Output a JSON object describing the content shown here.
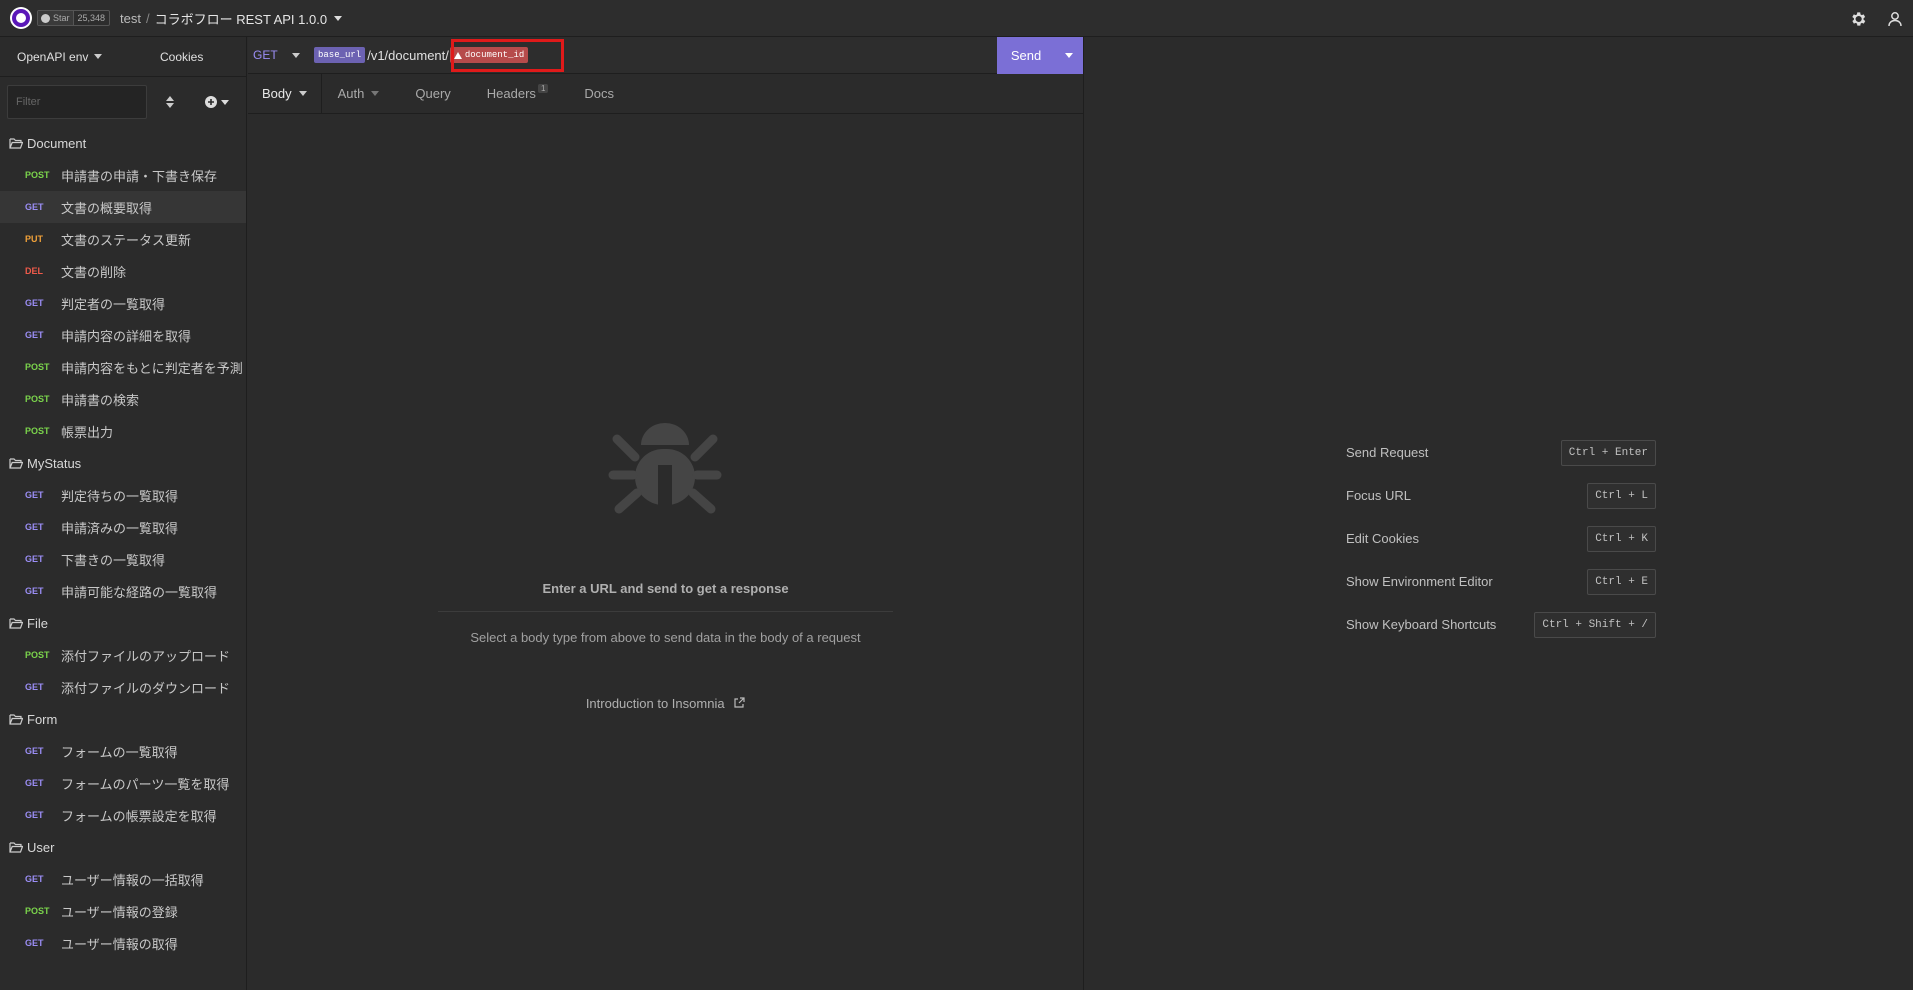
{
  "topbar": {
    "star_label": "Star",
    "star_count": "25,348",
    "workspace": "test",
    "separator": "/",
    "project": "コラボフロー REST API 1.0.0"
  },
  "sidebar": {
    "env_label": "OpenAPI env",
    "cookies_label": "Cookies",
    "filter_placeholder": "Filter",
    "groups": [
      {
        "name": "Document",
        "items": [
          {
            "method": "POST",
            "name": "申請書の申請・下書き保存"
          },
          {
            "method": "GET",
            "name": "文書の概要取得"
          },
          {
            "method": "PUT",
            "name": "文書のステータス更新"
          },
          {
            "method": "DEL",
            "name": "文書の削除"
          },
          {
            "method": "GET",
            "name": "判定者の一覧取得"
          },
          {
            "method": "GET",
            "name": "申請内容の詳細を取得"
          },
          {
            "method": "POST",
            "name": "申請内容をもとに判定者を予測"
          },
          {
            "method": "POST",
            "name": "申請書の検索"
          },
          {
            "method": "POST",
            "name": "帳票出力"
          }
        ]
      },
      {
        "name": "MyStatus",
        "items": [
          {
            "method": "GET",
            "name": "判定待ちの一覧取得"
          },
          {
            "method": "GET",
            "name": "申請済みの一覧取得"
          },
          {
            "method": "GET",
            "name": "下書きの一覧取得"
          },
          {
            "method": "GET",
            "name": "申請可能な経路の一覧取得"
          }
        ]
      },
      {
        "name": "File",
        "items": [
          {
            "method": "POST",
            "name": "添付ファイルのアップロード"
          },
          {
            "method": "GET",
            "name": "添付ファイルのダウンロード"
          }
        ]
      },
      {
        "name": "Form",
        "items": [
          {
            "method": "GET",
            "name": "フォームの一覧取得"
          },
          {
            "method": "GET",
            "name": "フォームのパーツ一覧を取得"
          },
          {
            "method": "GET",
            "name": "フォームの帳票設定を取得"
          }
        ]
      },
      {
        "name": "User",
        "items": [
          {
            "method": "GET",
            "name": "ユーザー情報の一括取得"
          },
          {
            "method": "POST",
            "name": "ユーザー情報の登録"
          },
          {
            "method": "GET",
            "name": "ユーザー情報の取得"
          }
        ]
      }
    ]
  },
  "request": {
    "method": "GET",
    "url_var": "base_url",
    "url_path": "/v1/document/",
    "url_err_var": "document_id",
    "send_label": "Send",
    "tabs": {
      "body": "Body",
      "auth": "Auth",
      "query": "Query",
      "headers": "Headers",
      "headers_count": "1",
      "docs": "Docs"
    },
    "empty_title": "Enter a URL and send to get a response",
    "empty_sub": "Select a body type from above to send data in the body of a request",
    "intro_link": "Introduction to Insomnia"
  },
  "response": {
    "shortcuts": [
      {
        "label": "Send Request",
        "keys": "Ctrl + Enter"
      },
      {
        "label": "Focus URL",
        "keys": "Ctrl + L"
      },
      {
        "label": "Edit Cookies",
        "keys": "Ctrl + K"
      },
      {
        "label": "Show Environment Editor",
        "keys": "Ctrl + E"
      },
      {
        "label": "Show Keyboard Shortcuts",
        "keys": "Ctrl + Shift + /"
      }
    ]
  },
  "colors": {
    "accent": "#7b6fd6",
    "get": "#9b8ef5",
    "post": "#7bd44c",
    "put": "#f1a23a",
    "del": "#ef5a4a",
    "error_var": "#b64b4b",
    "highlight_box": "#e01a1a"
  },
  "icons": {
    "logo": "insomnia-logo-icon",
    "github": "github-icon",
    "settings": "gear-icon",
    "account": "user-icon",
    "folder": "folder-open-icon",
    "bug": "bug-icon",
    "external": "external-link-icon"
  }
}
